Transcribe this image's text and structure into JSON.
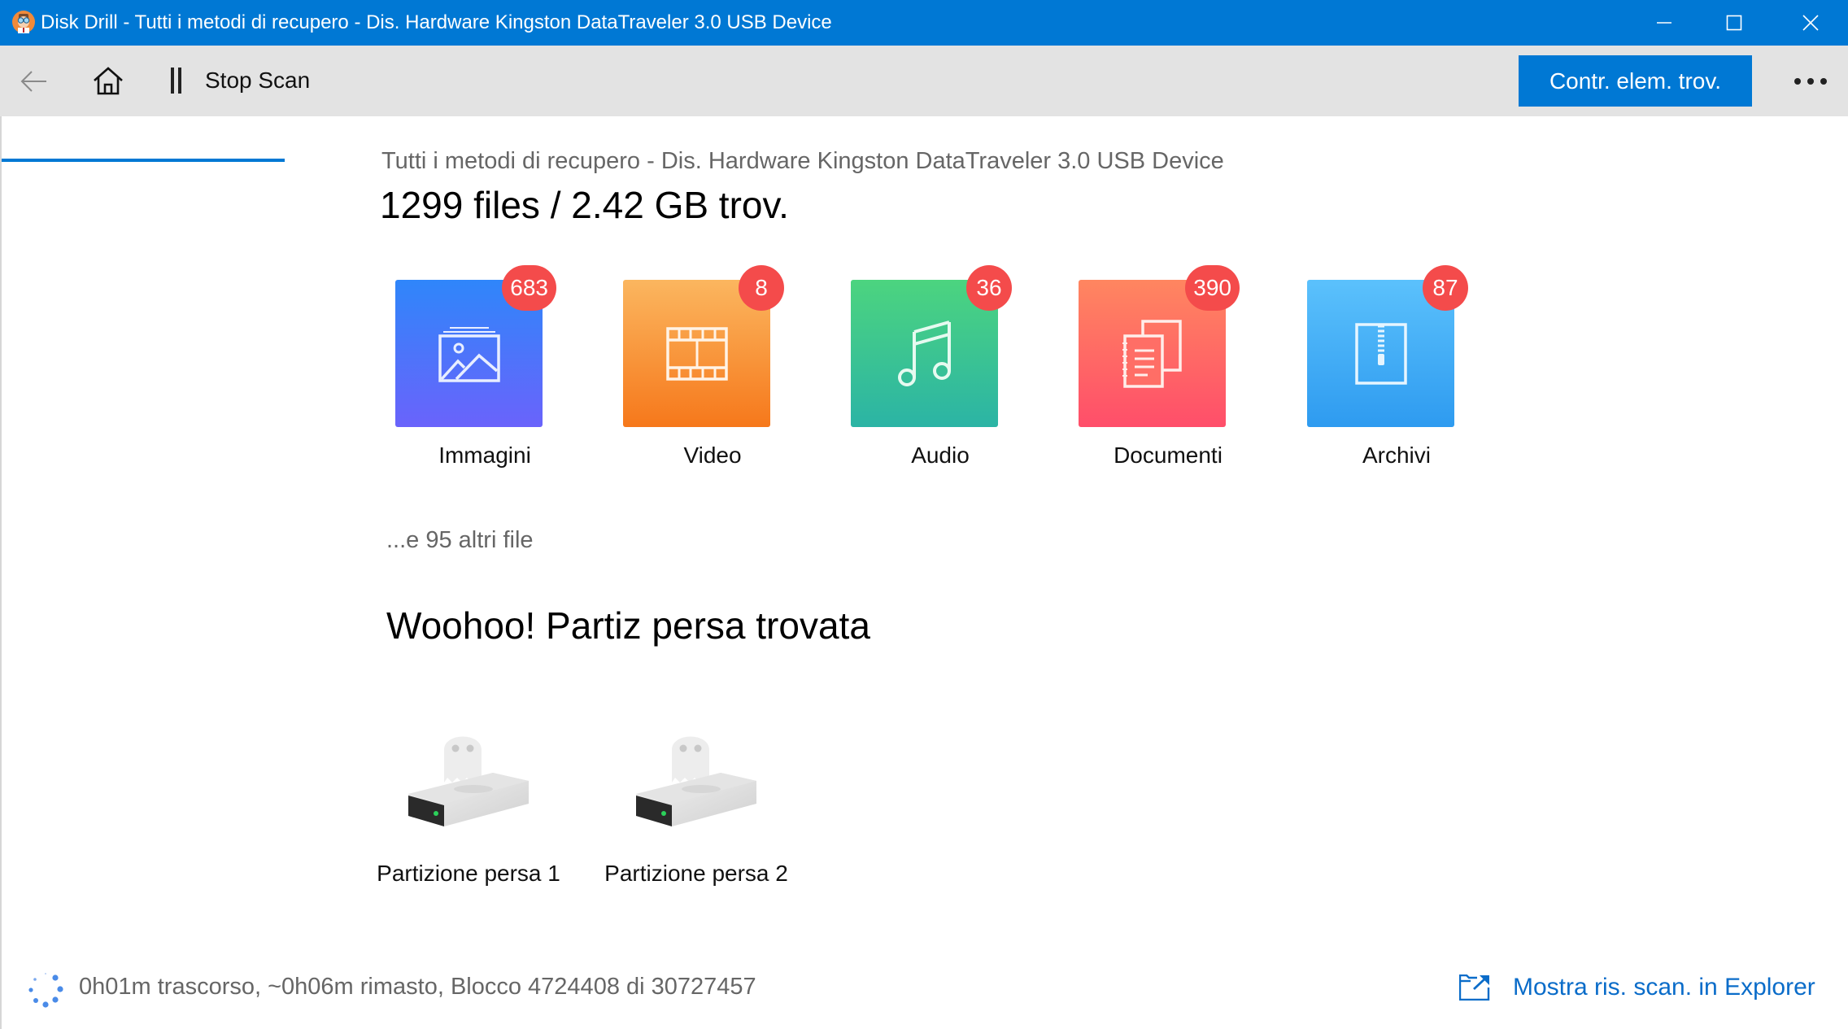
{
  "window": {
    "title": "Disk Drill - Tutti i metodi di recupero - Dis. Hardware Kingston DataTraveler 3.0 USB Device",
    "accent": "#0078D4",
    "controls": {
      "minimize": "minimize",
      "maximize": "maximize",
      "close": "close"
    }
  },
  "toolbar": {
    "back_icon": "arrow-left-icon",
    "home_icon": "home-icon",
    "stop_label": "Stop Scan",
    "primary_button": "Contr. elem. trov.",
    "more_icon": "more-horizontal-icon",
    "scan_progress_fraction": 0.154
  },
  "main": {
    "subtitle": "Tutti i metodi di recupero - Dis. Hardware Kingston DataTraveler 3.0 USB Device",
    "summary": "1299 files / 2.42 GB trov.",
    "categories": [
      {
        "label": "Immagini",
        "count": "683",
        "icon": "image-icon"
      },
      {
        "label": "Video",
        "count": "8",
        "icon": "film-icon"
      },
      {
        "label": "Audio",
        "count": "36",
        "icon": "music-note-icon"
      },
      {
        "label": "Documenti",
        "count": "390",
        "icon": "documents-icon"
      },
      {
        "label": "Archivi",
        "count": "87",
        "icon": "zip-archive-icon"
      }
    ],
    "badge_color": "#F44B4B",
    "more_files": "...e 95 altri file",
    "partition_heading": "Woohoo! Partiz persa trovata",
    "partitions": [
      {
        "label": "Partizione persa 1",
        "icon": "ghost-drive-icon"
      },
      {
        "label": "Partizione persa 2",
        "icon": "ghost-drive-icon"
      }
    ]
  },
  "status": {
    "text": "0h01m trascorso, ~0h06m rimasto, Blocco 4724408 di 30727457",
    "elapsed": "0h01m",
    "remaining": "~0h06m",
    "block_current": 4724408,
    "block_total": 30727457,
    "explorer_link": "Mostra ris. scan. in Explorer"
  }
}
